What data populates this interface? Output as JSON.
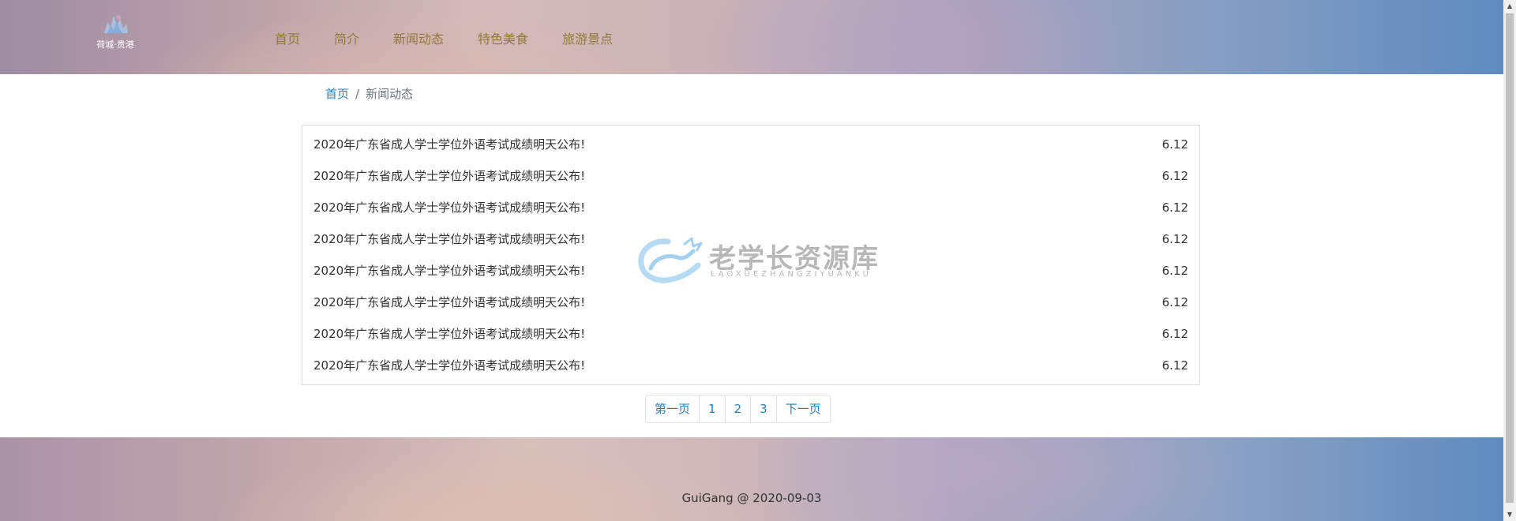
{
  "header": {
    "logo_text": "荷城·贵港",
    "nav": [
      {
        "label": "首页"
      },
      {
        "label": "简介"
      },
      {
        "label": "新闻动态"
      },
      {
        "label": "特色美食"
      },
      {
        "label": "旅游景点"
      }
    ]
  },
  "breadcrumb": {
    "home": "首页",
    "separator": "/",
    "current": "新闻动态"
  },
  "news": [
    {
      "title": "2020年广东省成人学士学位外语考试成绩明天公布!",
      "date": "6.12"
    },
    {
      "title": "2020年广东省成人学士学位外语考试成绩明天公布!",
      "date": "6.12"
    },
    {
      "title": "2020年广东省成人学士学位外语考试成绩明天公布!",
      "date": "6.12"
    },
    {
      "title": "2020年广东省成人学士学位外语考试成绩明天公布!",
      "date": "6.12"
    },
    {
      "title": "2020年广东省成人学士学位外语考试成绩明天公布!",
      "date": "6.12"
    },
    {
      "title": "2020年广东省成人学士学位外语考试成绩明天公布!",
      "date": "6.12"
    },
    {
      "title": "2020年广东省成人学士学位外语考试成绩明天公布!",
      "date": "6.12"
    },
    {
      "title": "2020年广东省成人学士学位外语考试成绩明天公布!",
      "date": "6.12"
    }
  ],
  "watermark": {
    "text": "老学长资源库",
    "subtext": "LAOXUEZHANGZIYUANKU"
  },
  "pagination": {
    "first": "第一页",
    "pages": [
      "1",
      "2",
      "3"
    ],
    "next": "下一页"
  },
  "footer": {
    "text": "GuiGang @ 2020-09-03"
  },
  "colors": {
    "nav_text": "#8f7a3a",
    "link": "#2c7fb8",
    "body_text": "#333333",
    "border": "#dcdcdc"
  }
}
